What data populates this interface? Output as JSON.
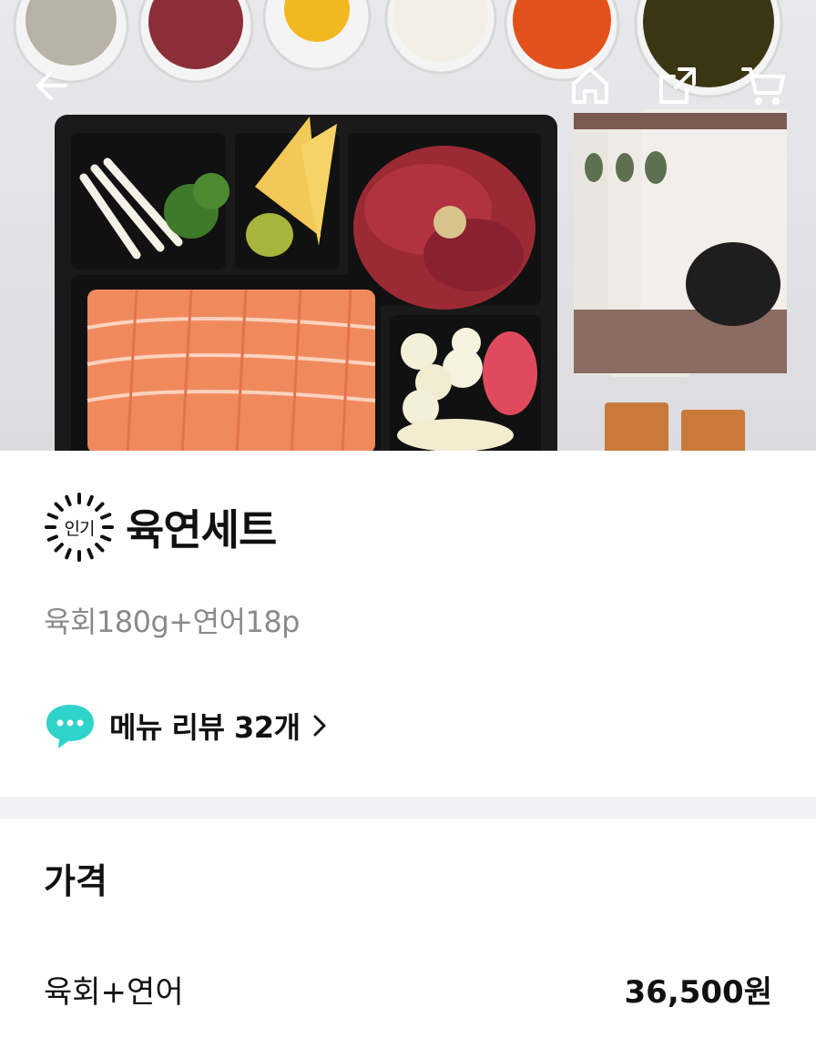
{
  "nav": {
    "back_icon": "arrow-left-icon",
    "home_icon": "home-icon",
    "share_icon": "share-icon",
    "cart_icon": "cart-icon"
  },
  "product": {
    "badge": "인기",
    "name": "육연세트",
    "description": "육회180g+연어18p"
  },
  "reviews": {
    "label": "메뉴 리뷰 32개",
    "icon": "speech-bubble-icon",
    "icon_color": "#2ed3c9"
  },
  "price": {
    "heading": "가격",
    "options": [
      {
        "name": "육회+연어",
        "price": "36,500원"
      }
    ]
  },
  "colors": {
    "divider": "#f2f2f4",
    "subtitle_text": "#8a8a8a"
  }
}
